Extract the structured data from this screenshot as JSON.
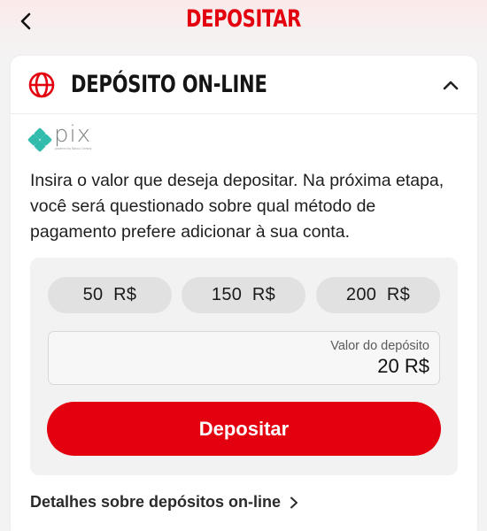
{
  "header": {
    "title": "DEPOSITAR",
    "back_icon": "chevron-left-icon"
  },
  "section": {
    "title": "DEPÓSITO ON-LINE",
    "icon": "globe-icon",
    "toggle_icon": "chevron-up-icon",
    "expanded": true
  },
  "payment_method": {
    "logo_text": "pix",
    "logo_subtext": "powered by Banco Central"
  },
  "description": "Insira o valor que deseja depositar. Na próxima etapa, você será questionado sobre qual método de pagamento prefere adicionar à sua conta.",
  "quick_amounts": [
    {
      "label": "50  R$"
    },
    {
      "label": "150  R$"
    },
    {
      "label": "200  R$"
    }
  ],
  "amount_field": {
    "label": "Valor do depósito",
    "value": "20 R$"
  },
  "deposit_button": {
    "label": "Depositar"
  },
  "details_link": {
    "label": "Detalhes sobre depósitos on-line"
  },
  "colors": {
    "accent": "#e3000f",
    "chip_bg": "#e1e1e1",
    "panel_bg": "#f2f2f2",
    "pix_teal": "#32bcad"
  }
}
